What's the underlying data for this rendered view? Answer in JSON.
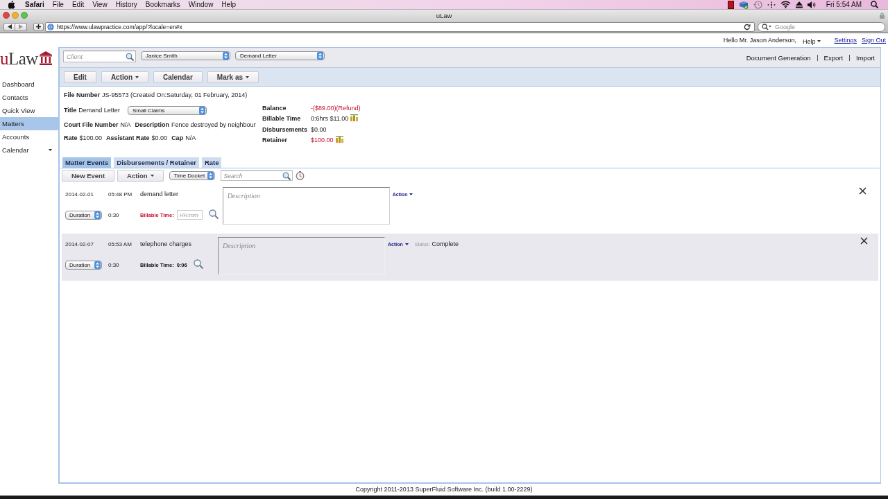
{
  "menu_bar": {
    "app": "Safari",
    "items": [
      "File",
      "Edit",
      "View",
      "History",
      "Bookmarks",
      "Window",
      "Help"
    ],
    "clock": "Fri 5:54 AM"
  },
  "browser": {
    "title": "uLaw",
    "url": "https://www.ulawpractice.com/app/?locale=en#x",
    "search": {
      "placeholder": "Google"
    }
  },
  "user_bar": {
    "greeting": "Hello Mr. Jason Anderson,",
    "menu": "Help",
    "links": [
      "Settings",
      "Sign Out"
    ]
  },
  "logo": {
    "text": "uLaw"
  },
  "sidebar": {
    "items": [
      {
        "label": "Dashboard",
        "selected": false,
        "dropdown": false
      },
      {
        "label": "Contacts",
        "selected": false,
        "dropdown": false
      },
      {
        "label": "Quick View",
        "selected": false,
        "dropdown": false
      },
      {
        "label": "Matters",
        "selected": true,
        "dropdown": false
      },
      {
        "label": "Accounts",
        "selected": false,
        "dropdown": false
      },
      {
        "label": "Calendar",
        "selected": false,
        "dropdown": true
      }
    ]
  },
  "top_bar": {
    "client": {
      "placeholder": "Client"
    },
    "selects": [
      "Janice Smith",
      "Demand Letter"
    ],
    "links": [
      "Document Generation",
      "Export",
      "Import"
    ]
  },
  "toolbar": {
    "buttons": [
      {
        "label": "Edit",
        "dropdown": false
      },
      {
        "label": "Action",
        "dropdown": true
      },
      {
        "label": "Calendar",
        "dropdown": false
      },
      {
        "label": "Mark as",
        "dropdown": true
      }
    ]
  },
  "details": {
    "file": {
      "label": "File Number",
      "value": "JS-95573 (Created On:Saturday, 01 February, 2014)"
    },
    "title": {
      "label": "Title",
      "value": "Demand Letter",
      "select": "Small Claims"
    },
    "rows": [
      [
        {
          "label": "Court File Number",
          "value": "N/A"
        },
        {
          "label": "Description",
          "value": "Fence destroyed by neighbour"
        }
      ],
      [
        {
          "label": "Rate",
          "value": "$100.00"
        },
        {
          "label": "Assistant Rate",
          "value": "$0.00"
        },
        {
          "label": "Cap",
          "value": "N/A"
        }
      ]
    ],
    "summary": [
      {
        "label": "Balance",
        "value": "-($89.00)(Refund)",
        "alert": true,
        "icon": false
      },
      {
        "label": "Billable Time",
        "value": "0:6hrs $11.00",
        "alert": false,
        "icon": true
      },
      {
        "label": "Disbursements",
        "value": "$0.00",
        "alert": false,
        "icon": false
      },
      {
        "label": "Retainer",
        "value": "$100.00",
        "alert": true,
        "icon": true
      }
    ]
  },
  "tabs": [
    {
      "label": "Matter Events",
      "selected": true
    },
    {
      "label": "Disbursements / Retainer",
      "selected": false
    },
    {
      "label": "Rate",
      "selected": false
    }
  ],
  "events_toolbar": {
    "buttons": [
      {
        "label": "New Event",
        "dropdown": false
      },
      {
        "label": "Action",
        "dropdown": true
      }
    ],
    "select": "Time Docket",
    "search": {
      "placeholder": "Search"
    }
  },
  "events": [
    {
      "selected": false,
      "date": "2014-02-01",
      "time": "05:48 PM",
      "title": "demand letter",
      "duration_select": "Duration",
      "duration": "0:30",
      "billable": {
        "label": "Billable Time:",
        "placeholder": "HH:mm"
      },
      "description": {
        "placeholder": "Description"
      },
      "action": "Action"
    },
    {
      "selected": true,
      "date": "2014-02-07",
      "time": "05:53 AM",
      "title": "telephone charges",
      "duration_select": "Duration",
      "duration": "0:30",
      "billable": {
        "label": "Billable Time:",
        "value": "0:06"
      },
      "description": {
        "placeholder": "Description"
      },
      "action": "Action",
      "status": {
        "label": "Status:",
        "value": "Complete"
      }
    }
  ],
  "footer": "Copyright 2011-2013 SuperFluid Software Inc. (build 1.00-2229)"
}
